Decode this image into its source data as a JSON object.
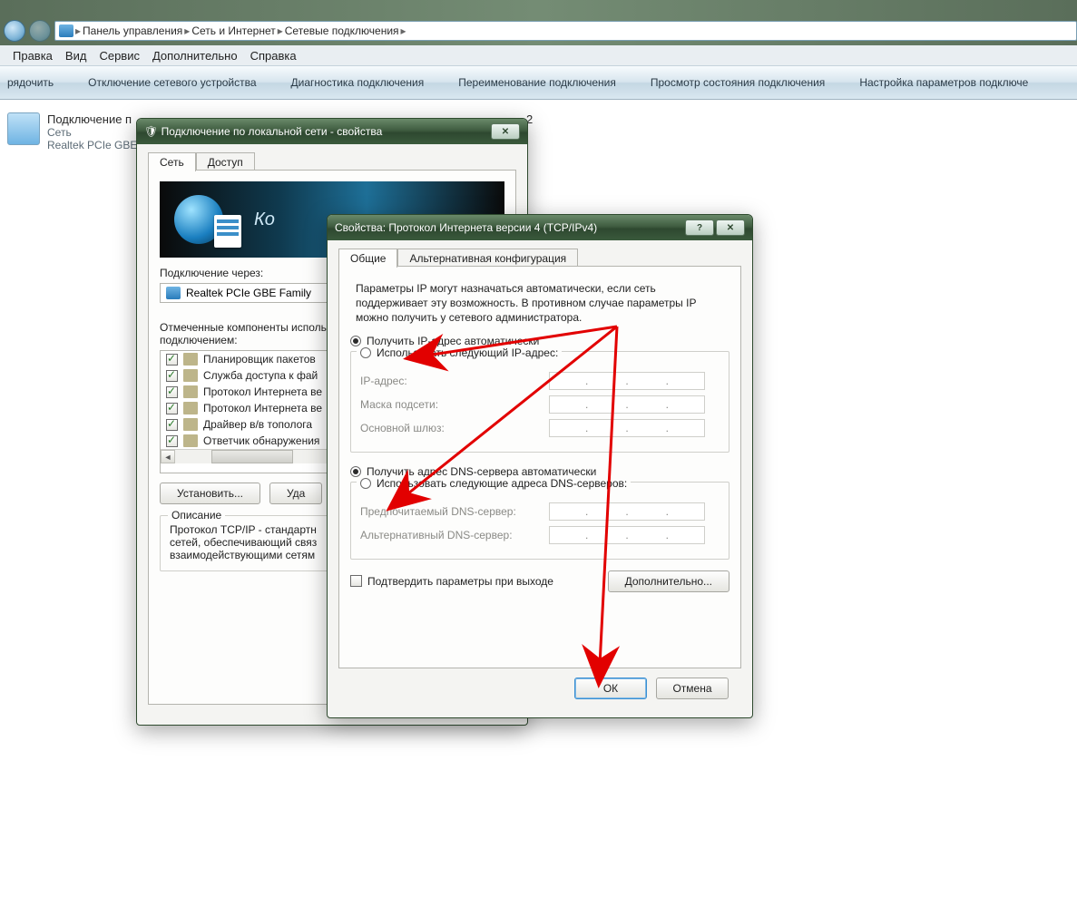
{
  "breadcrumb": {
    "item1": "Панель управления",
    "item2": "Сеть и Интернет",
    "item3": "Сетевые подключения"
  },
  "menubar": {
    "edit": "Правка",
    "view": "Вид",
    "service": "Сервис",
    "advanced": "Дополнительно",
    "help": "Справка"
  },
  "toolbar": {
    "organize": "рядочить",
    "disable": "Отключение сетевого устройства",
    "diagnose": "Диагностика подключения",
    "rename": "Переименование подключения",
    "status": "Просмотр состояния подключения",
    "settings": "Настройка параметров подключе"
  },
  "netitem": {
    "title": "Подключение п",
    "line2": "Сеть",
    "line3": "Realtek PCIe GBE",
    "ghost": "2"
  },
  "dlg1": {
    "title": "Подключение по локальной сети - свойства",
    "banner_txt": "Ко",
    "tab_net": "Сеть",
    "tab_access": "Доступ",
    "connect_via": "Подключение через:",
    "adapter": "Realtek PCIe GBE Family",
    "components_lbl": "Отмеченные компоненты исполь\nподключением:",
    "components": [
      "Планировщик пакетов",
      "Служба доступа к фай",
      "Протокол Интернета ве",
      "Протокол Интернета ве",
      "Драйвер в/в тополога",
      "Ответчик обнаружения"
    ],
    "install": "Установить...",
    "uninstall": "Уда",
    "desc_title": "Описание",
    "desc_body": "Протокол TCP/IP - стандартн\nсетей, обеспечивающий связ\nвзаимодействующими сетям"
  },
  "dlg2": {
    "title": "Свойства: Протокол Интернета версии 4 (TCP/IPv4)",
    "tab_general": "Общие",
    "tab_alt": "Альтернативная конфигурация",
    "help": "Параметры IP могут назначаться автоматически, если сеть поддерживает эту возможность. В противном случае параметры IP можно получить у сетевого администратора.",
    "r_ip_auto": "Получить IP-адрес автоматически",
    "r_ip_manual": "Использовать следующий IP-адрес:",
    "f_ip": "IP-адрес:",
    "f_mask": "Маска подсети:",
    "f_gw": "Основной шлюз:",
    "r_dns_auto": "Получить адрес DNS-сервера автоматически",
    "r_dns_manual": "Использовать следующие адреса DNS-серверов:",
    "f_dns1": "Предпочитаемый DNS-сервер:",
    "f_dns2": "Альтернативный DNS-сервер:",
    "validate": "Подтвердить параметры при выходе",
    "advanced": "Дополнительно...",
    "ok": "ОК",
    "cancel": "Отмена"
  }
}
